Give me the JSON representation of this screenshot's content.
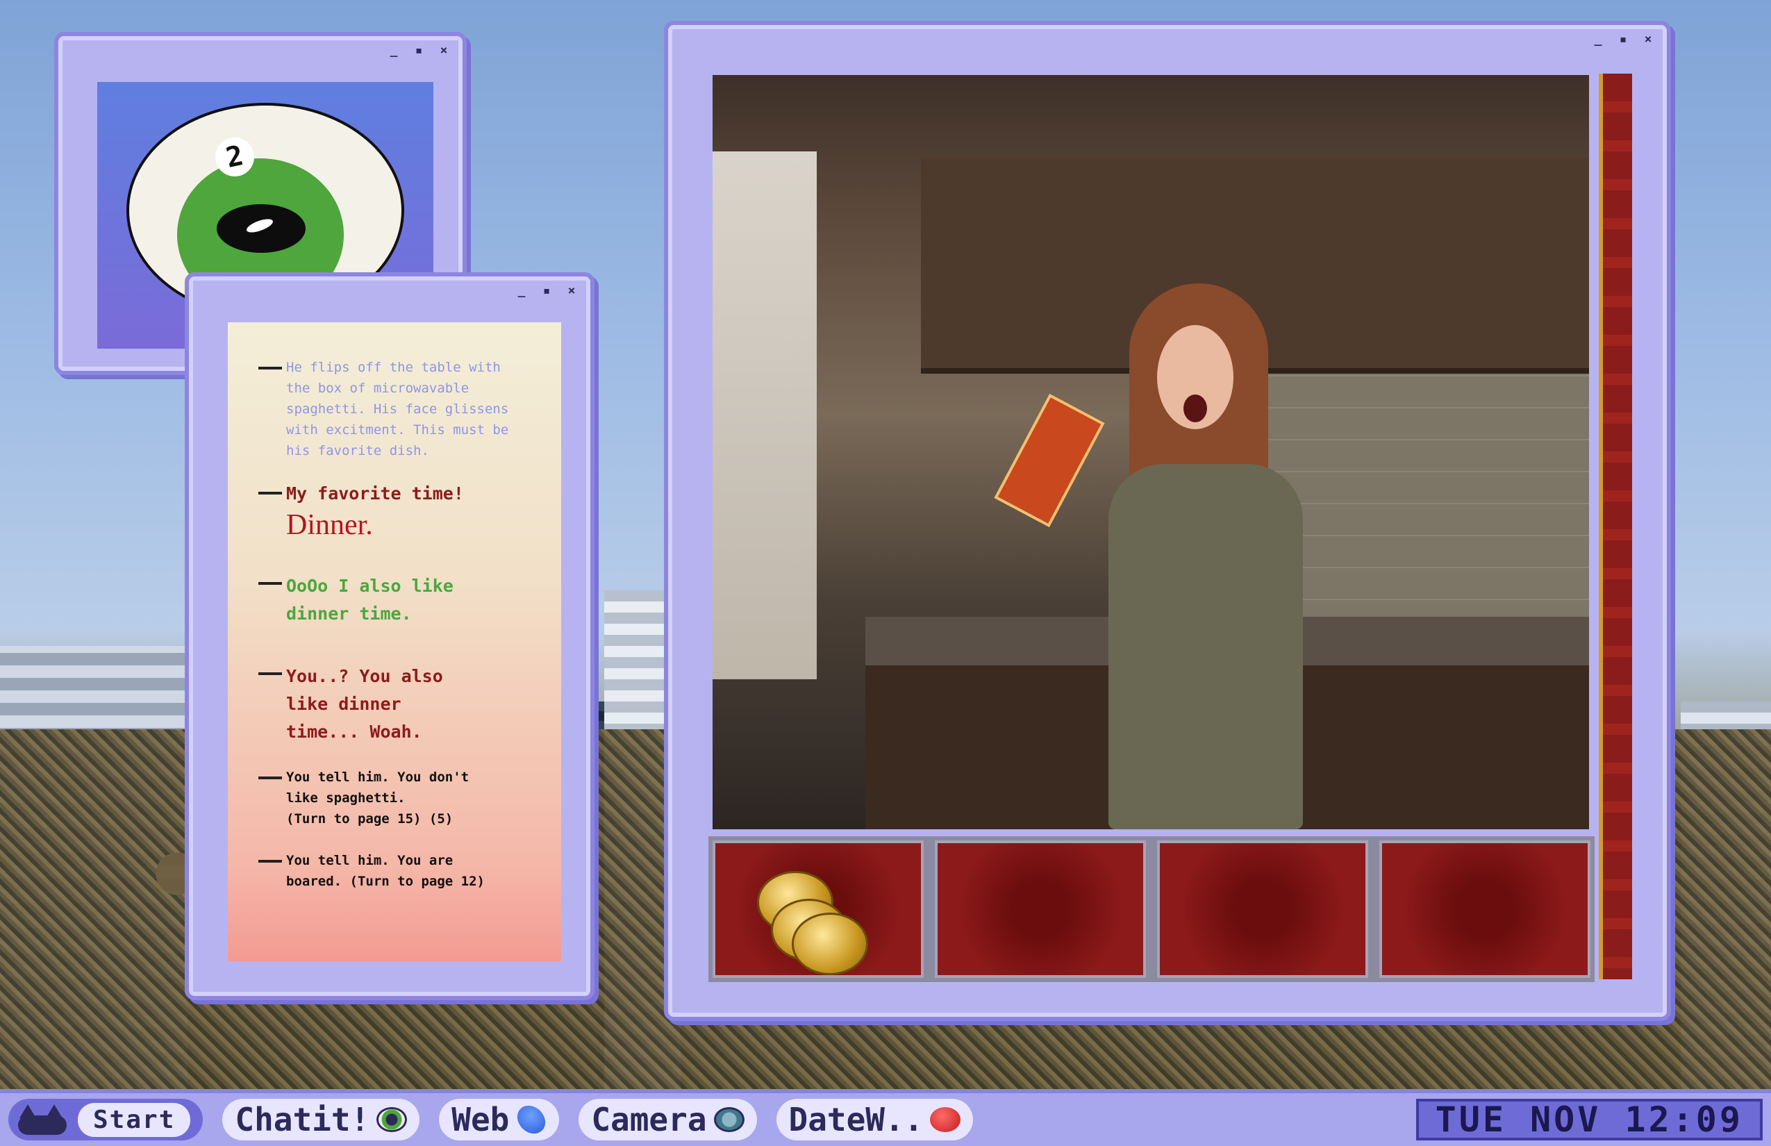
{
  "windows": {
    "eye": {
      "number": "2"
    },
    "story": {
      "entries": [
        {
          "text": "He flips off the table with\nthe box of microwavable\nspaghetti. His face glissens\nwith excitment. This must be\nhis favorite dish."
        },
        {
          "text": "My favorite time!",
          "emphasis": "Dinner."
        },
        {
          "text": "OoOo I also like\ndinner time."
        },
        {
          "text": "You..? You also\nlike dinner\ntime... Woah."
        },
        {
          "text": "You tell him. You don't\nlike spaghetti.\n(Turn to page 15) (5)"
        },
        {
          "text": "You tell him. You are\nboared. (Turn to page 12)"
        }
      ]
    },
    "controls": {
      "minimize": "_",
      "maximize": "▪",
      "close": "×"
    }
  },
  "camera": {
    "inventory": [
      "gold-coins",
      "",
      "",
      ""
    ]
  },
  "taskbar": {
    "start_label": "Start",
    "tasks": [
      {
        "label": "Chatit!",
        "icon": "eye-icon"
      },
      {
        "label": "Web",
        "icon": "globe-icon"
      },
      {
        "label": "Camera",
        "icon": "camera-icon"
      },
      {
        "label": "DateW..",
        "icon": "heart-icon"
      }
    ],
    "clock": "TUE NOV 12:09"
  },
  "colors": {
    "window_frame": "#8c86e0",
    "window_bg": "#b7b3f0",
    "taskbar": "#a8a6ec",
    "slot_red": "#8d1a1a"
  }
}
